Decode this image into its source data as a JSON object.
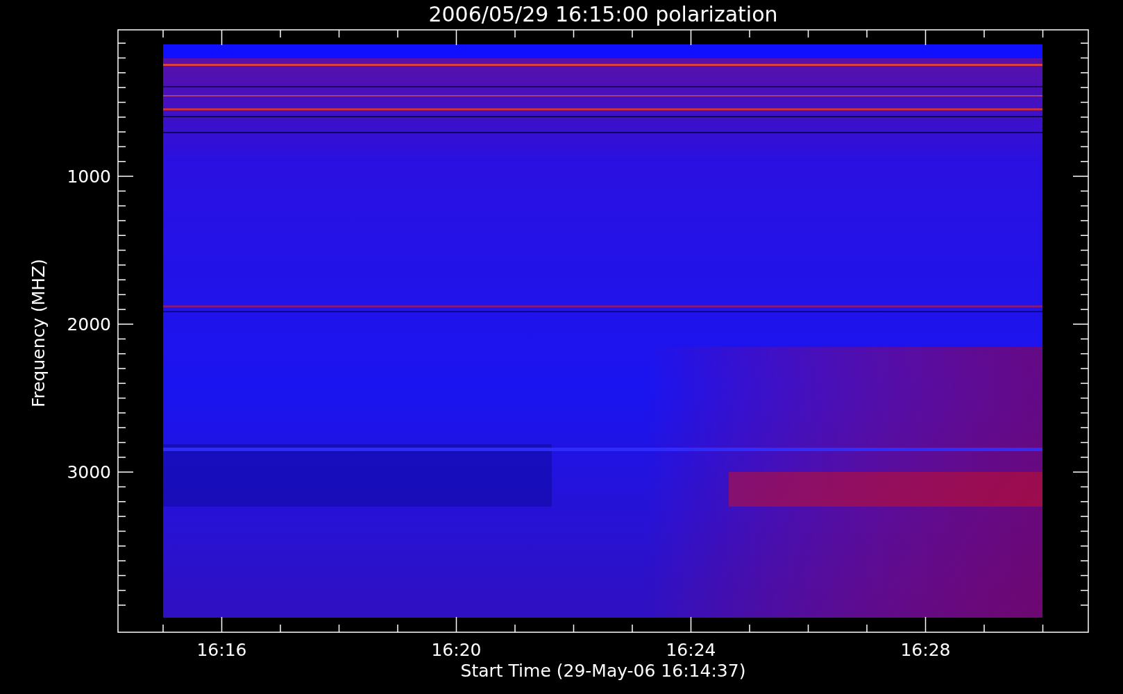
{
  "title": "2006/05/29 16:15:00 polarization",
  "ylabel": "Frequency (MHZ)",
  "yticks": [
    "1000",
    "2000",
    "3000"
  ],
  "xticks": [
    "16:16",
    "16:20",
    "16:24",
    "16:28"
  ],
  "xlabel": "Start Time (29-May-06 16:14:37)"
}
